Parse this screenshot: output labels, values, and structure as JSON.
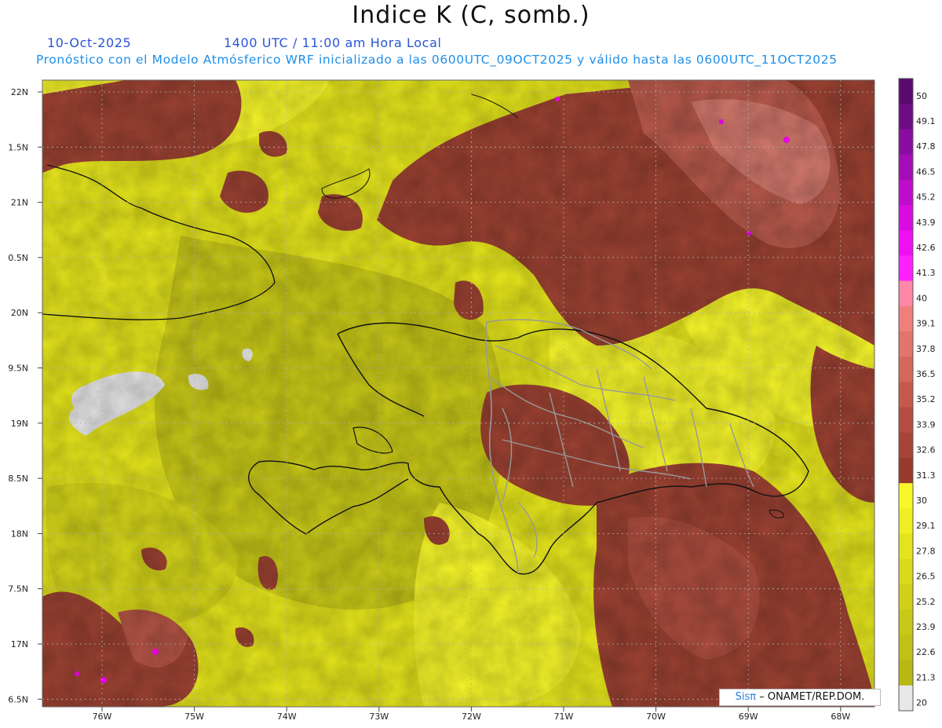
{
  "header": {
    "title": "Indice K (C, somb.)",
    "date": "10-Oct-2025",
    "time": "1400 UTC / 11:00 am Hora Local",
    "subtitle": "Pronóstico con el Modelo Atmósferico WRF inicializado a las 0600UTC_09OCT2025 y válido hasta las  0600UTC_11OCT2025"
  },
  "map": {
    "lat_labels": [
      "22N",
      "1.5N",
      "21N",
      "0.5N",
      "20N",
      "9.5N",
      "19N",
      "8.5N",
      "18N",
      "7.5N",
      "17N",
      "6.5N"
    ],
    "lon_labels": [
      "76W",
      "75W",
      "74W",
      "73W",
      "72W",
      "71W",
      "70W",
      "69W",
      "68W"
    ],
    "colors": {
      "background_low": "#c4c417",
      "mid": "#e8e818",
      "yellow": "#f5f52a",
      "brown": "#9c4232",
      "brown_light": "#c6695a",
      "pink": "#e8909a",
      "magenta": "#ff00ff",
      "gray": "#e6e6e6",
      "coast": "#111111",
      "province": "#9a9a9a"
    }
  },
  "colorbar": {
    "labels": [
      "50",
      "49.1",
      "47.8",
      "46.5",
      "45.2",
      "43.9",
      "42.6",
      "41.3",
      "40",
      "39.1",
      "37.8",
      "36.5",
      "35.2",
      "33.9",
      "32.6",
      "31.3",
      "30",
      "29.1",
      "27.8",
      "26.5",
      "25.2",
      "23.9",
      "22.6",
      "21.3",
      "20"
    ],
    "colors": [
      "#5a0a6e",
      "#6e0c86",
      "#8a0ca0",
      "#a40cb8",
      "#c00ccc",
      "#d80ce0",
      "#ee10f0",
      "#ff20ff",
      "#ff88a8",
      "#f07f7c",
      "#e2746c",
      "#d4685c",
      "#c45a4c",
      "#b44e40",
      "#a64436",
      "#963a2c",
      "#f7f72a",
      "#eeee22",
      "#e4e41e",
      "#dada1c",
      "#d0d01a",
      "#c8c818",
      "#c0c016",
      "#b8b814",
      "#e8e8e8"
    ]
  },
  "credit": {
    "logo": "Sisπ",
    "text": "– ONAMET/REP.DOM."
  }
}
